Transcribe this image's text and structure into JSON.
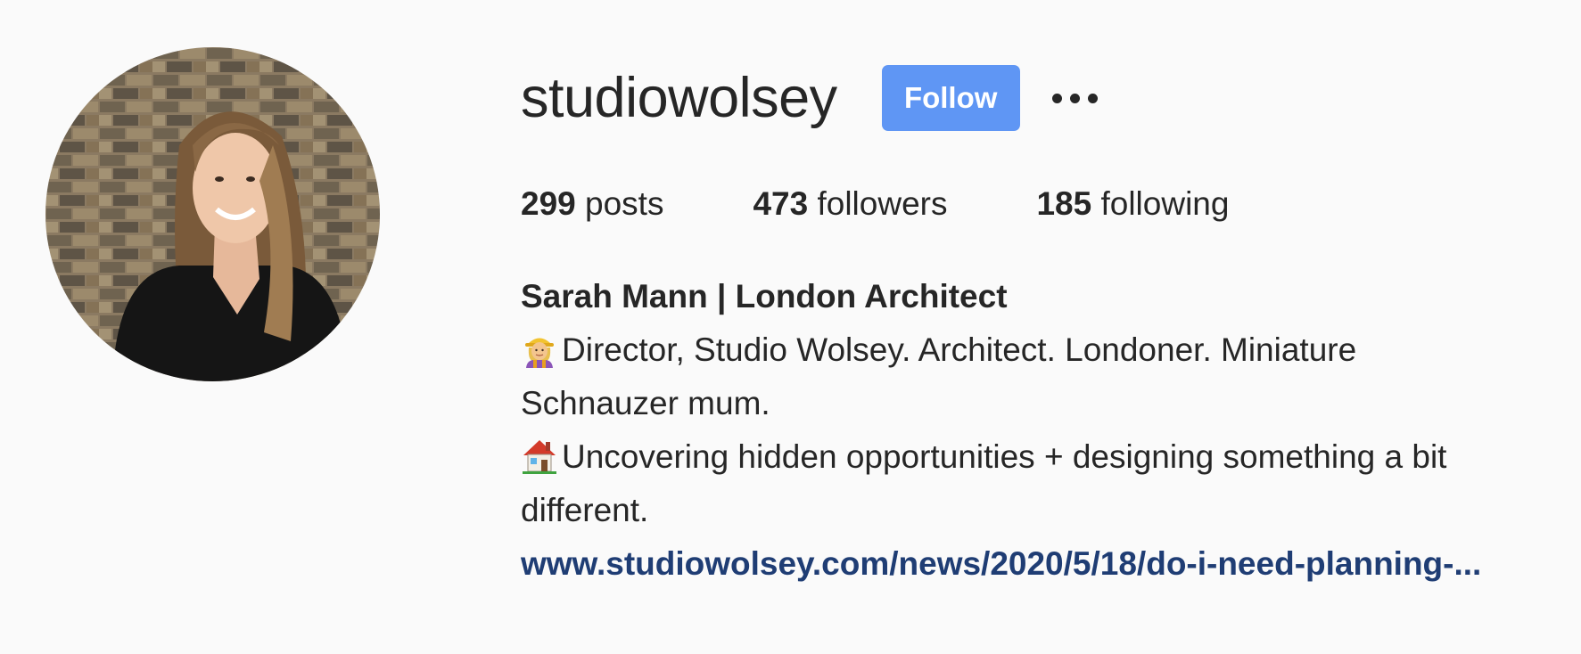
{
  "profile": {
    "username": "studiowolsey",
    "follow_label": "Follow",
    "more_icon": "more-horizontal-icon"
  },
  "stats": {
    "posts_count": "299",
    "posts_label": "posts",
    "followers_count": "473",
    "followers_label": "followers",
    "following_count": "185",
    "following_label": "following"
  },
  "bio": {
    "full_name": "Sarah Mann | London Architect",
    "line1_icon": "woman-construction-worker-icon",
    "line1": "Director, Studio Wolsey. Architect. Londoner. Miniature",
    "line2": "Schnauzer mum.",
    "line3_icon": "house-icon",
    "line3": "Uncovering hidden opportunities + designing something a bit",
    "line4": "different.",
    "link": "www.studiowolsey.com/news/2020/5/18/do-i-need-planning-..."
  },
  "colors": {
    "background": "#fafafa",
    "text": "#262626",
    "follow_button": "#5f96f4",
    "link": "#1f3d74"
  }
}
